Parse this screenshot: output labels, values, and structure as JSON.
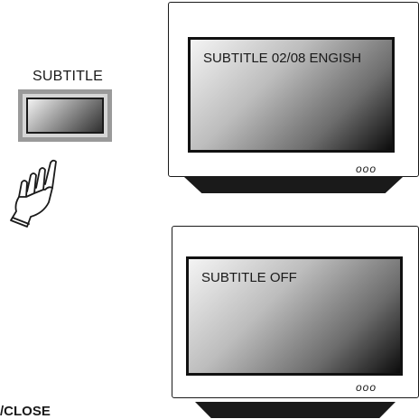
{
  "remote": {
    "button_label": "SUBTITLE",
    "hand_icon": "pointing-hand-icon"
  },
  "tv_top": {
    "osd_text": "SUBTITLE 02/08 ENGISH",
    "indicators": "ooo"
  },
  "tv_bottom": {
    "osd_text": "SUBTITLE OFF",
    "indicators": "ooo"
  },
  "footer": {
    "caption": "/CLOSE"
  }
}
